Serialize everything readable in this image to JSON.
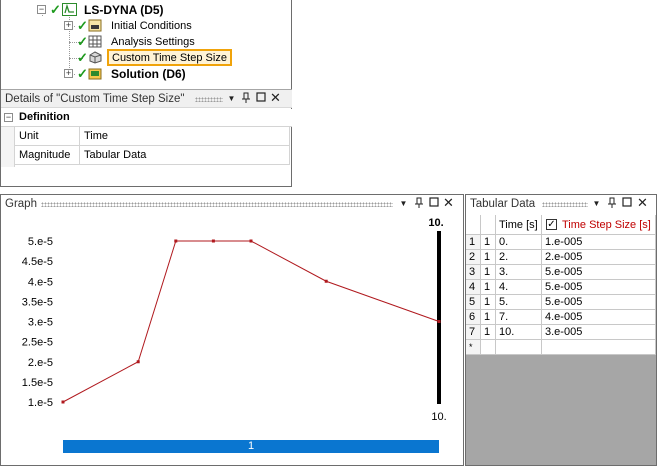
{
  "tree": {
    "root_label": "LS-DYNA (D5)",
    "items": [
      {
        "label": "Initial Conditions"
      },
      {
        "label": "Analysis Settings"
      },
      {
        "label": "Custom Time Step Size"
      },
      {
        "label": "Solution (D6)"
      }
    ]
  },
  "details": {
    "title": "Details of \"Custom Time Step Size\"",
    "section": "Definition",
    "rows": [
      {
        "name": "Unit",
        "value": "Time"
      },
      {
        "name": "Magnitude",
        "value": "Tabular Data"
      }
    ]
  },
  "graph": {
    "title": "Graph",
    "top_right_label": "10.",
    "timeline_label": "1"
  },
  "tabular": {
    "title": "Tabular Data",
    "col_time": "Time [s]",
    "col_step": "Time Step Size [s]",
    "rows": [
      {
        "idx": "1",
        "step": "1",
        "time": "0.",
        "value": "1.e-005"
      },
      {
        "idx": "2",
        "step": "1",
        "time": "2.",
        "value": "2.e-005"
      },
      {
        "idx": "3",
        "step": "1",
        "time": "3.",
        "value": "5.e-005"
      },
      {
        "idx": "4",
        "step": "1",
        "time": "4.",
        "value": "5.e-005"
      },
      {
        "idx": "5",
        "step": "1",
        "time": "5.",
        "value": "5.e-005"
      },
      {
        "idx": "6",
        "step": "1",
        "time": "7.",
        "value": "4.e-005"
      },
      {
        "idx": "7",
        "step": "1",
        "time": "10.",
        "value": "3.e-005"
      }
    ],
    "new_row_marker": "*"
  },
  "chart_data": {
    "type": "line",
    "x": [
      0,
      2,
      3,
      4,
      5,
      7,
      10
    ],
    "series": [
      {
        "values": [
          1e-05,
          2e-05,
          5e-05,
          5e-05,
          5e-05,
          4e-05,
          3e-05
        ]
      }
    ],
    "y_tick_labels": [
      "5.e-5",
      "4.5e-5",
      "4.e-5",
      "3.5e-5",
      "3.e-5",
      "2.5e-5",
      "2.e-5",
      "1.5e-5",
      "1.e-5"
    ],
    "y_ticks": [
      5e-05,
      4.5e-05,
      4e-05,
      3.5e-05,
      3e-05,
      2.5e-05,
      2e-05,
      1.5e-05,
      1e-05
    ],
    "x_tick_label": "10.",
    "xlim": [
      0,
      10
    ],
    "ylim": [
      1e-05,
      5e-05
    ],
    "color": "#b0191e",
    "grid": false
  },
  "colors": {
    "selected_border": "#f0a30a",
    "selected_fill": "#fff3d6",
    "timeline_fill": "#0a76d0",
    "check_green": "#1e9a1e",
    "series_red": "#b0191e",
    "highlight_header": "#c00000"
  }
}
